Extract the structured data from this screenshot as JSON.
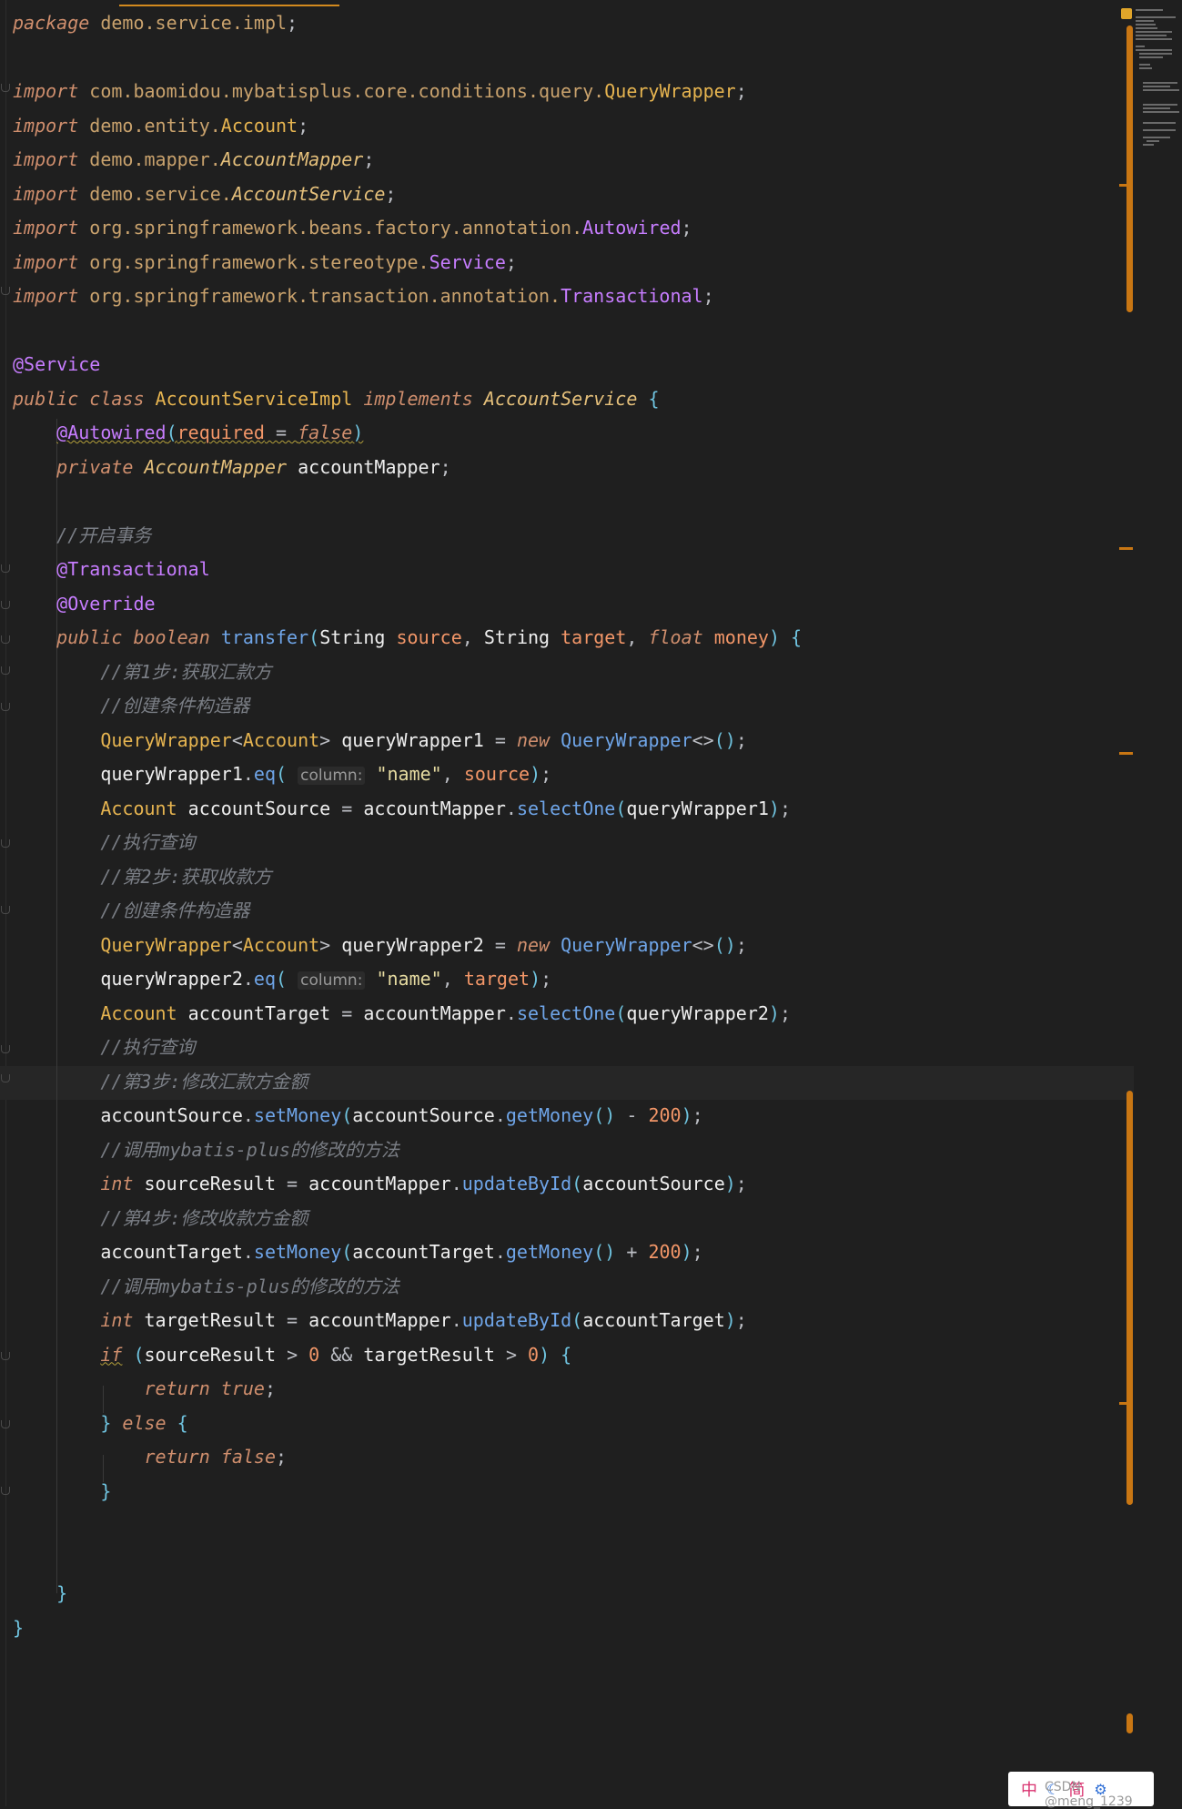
{
  "editor": {
    "language": "Java",
    "lines": [
      {
        "y": 0,
        "html": "<span class='kw'>package</span> <span class='ty'>demo.service.impl</span><span class='punc'>;</span>"
      },
      {
        "y": 2,
        "html": "<span class='kw'>import</span> <span class='ty'>com.baomidou.mybatisplus.core.conditions.query.</span><span class='cls'>QueryWrapper</span><span class='punc'>;</span>"
      },
      {
        "y": 3,
        "html": "<span class='kw'>import</span> <span class='ty'>demo.entity.</span><span class='cls'>Account</span><span class='punc'>;</span>"
      },
      {
        "y": 4,
        "html": "<span class='kw'>import</span> <span class='ty'>demo.mapper.</span><span class='ity'>AccountMapper</span><span class='punc'>;</span>"
      },
      {
        "y": 5,
        "html": "<span class='kw'>import</span> <span class='ty'>demo.service.</span><span class='ity'>AccountService</span><span class='punc'>;</span>"
      },
      {
        "y": 6,
        "html": "<span class='kw'>import</span> <span class='ty'>org.springframework.beans.factory.annotation.</span><span class='ann'>Autowired</span><span class='punc'>;</span>"
      },
      {
        "y": 7,
        "html": "<span class='kw'>import</span> <span class='ty'>org.springframework.stereotype.</span><span class='ann'>Service</span><span class='punc'>;</span>"
      },
      {
        "y": 8,
        "html": "<span class='kw'>import</span> <span class='ty'>org.springframework.transaction.annotation.</span><span class='ann'>Transactional</span><span class='punc'>;</span>"
      },
      {
        "y": 10,
        "html": "<span class='ann'>@Service</span>"
      },
      {
        "y": 11,
        "html": "<span class='kw'>public class</span> <span class='cls'>AccountServiceImpl</span> <span class='kw'>implements</span> <span class='ity'>AccountService</span> <span class='brace'>{</span>"
      },
      {
        "y": 12,
        "html": "    <span class='ann squiggle'>@Autowired</span><span class='brace squiggle'>(</span><span class='var squiggle'>required</span><span class='punc squiggle'> = </span><span class='kw squiggle'>false</span><span class='brace squiggle'>)</span>"
      },
      {
        "y": 13,
        "html": "    <span class='kw'>private</span> <span class='ity'>AccountMapper</span> <span class='plain'>accountMapper</span><span class='punc'>;</span>"
      },
      {
        "y": 15,
        "html": "    <span class='cmt'>//开启事务</span>"
      },
      {
        "y": 16,
        "html": "    <span class='ann'>@Transactional</span>"
      },
      {
        "y": 17,
        "html": "    <span class='ann'>@Override</span>"
      },
      {
        "y": 18,
        "html": "    <span class='kw'>public</span> <span class='kw'>boolean</span> <span class='fn'>transfer</span><span class='brace'>(</span><span class='plain'>String</span> <span class='var'>source</span><span class='punc'>, </span><span class='plain'>String</span> <span class='var'>target</span><span class='punc'>, </span><span class='kw'>float</span> <span class='var'>money</span><span class='brace'>)</span> <span class='brace'>{</span>"
      },
      {
        "y": 19,
        "html": "        <span class='cmt'>//第1步:获取汇款方</span>"
      },
      {
        "y": 20,
        "html": "        <span class='cmt'>//创建条件构造器</span>"
      },
      {
        "y": 21,
        "html": "        <span class='cls'>QueryWrapper</span><span class='punc'>&lt;</span><span class='cls'>Account</span><span class='punc'>&gt;</span> <span class='plain'>queryWrapper1</span> <span class='punc'>=</span> <span class='kw'>new</span> <span class='fn'>QueryWrapper</span><span class='punc'>&lt;&gt;</span><span class='brace'>()</span><span class='punc'>;</span>"
      },
      {
        "y": 22,
        "html": "        <span class='plain'>queryWrapper1</span><span class='punc'>.</span><span class='fn'>eq</span><span class='brace'>(</span> <span class='hint'>column:</span> <span class='str'>\"name\"</span><span class='punc'>, </span><span class='var'>source</span><span class='brace'>)</span><span class='punc'>;</span>"
      },
      {
        "y": 23,
        "html": "        <span class='cls'>Account</span> <span class='plain'>accountSource</span> <span class='punc'>=</span> <span class='plain'>accountMapper</span><span class='punc'>.</span><span class='fn'>selectOne</span><span class='brace'>(</span><span class='plain'>queryWrapper1</span><span class='brace'>)</span><span class='punc'>;</span>"
      },
      {
        "y": 24,
        "html": "        <span class='cmt'>//执行查询</span>"
      },
      {
        "y": 25,
        "html": "        <span class='cmt'>//第2步:获取收款方</span>"
      },
      {
        "y": 26,
        "html": "        <span class='cmt'>//创建条件构造器</span>"
      },
      {
        "y": 27,
        "html": "        <span class='cls'>QueryWrapper</span><span class='punc'>&lt;</span><span class='cls'>Account</span><span class='punc'>&gt;</span> <span class='plain'>queryWrapper2</span> <span class='punc'>=</span> <span class='kw'>new</span> <span class='fn'>QueryWrapper</span><span class='punc'>&lt;&gt;</span><span class='brace'>()</span><span class='punc'>;</span>"
      },
      {
        "y": 28,
        "html": "        <span class='plain'>queryWrapper2</span><span class='punc'>.</span><span class='fn'>eq</span><span class='brace'>(</span> <span class='hint'>column:</span> <span class='str'>\"name\"</span><span class='punc'>, </span><span class='var'>target</span><span class='brace'>)</span><span class='punc'>;</span>"
      },
      {
        "y": 29,
        "html": "        <span class='cls'>Account</span> <span class='plain'>accountTarget</span> <span class='punc'>=</span> <span class='plain'>accountMapper</span><span class='punc'>.</span><span class='fn'>selectOne</span><span class='brace'>(</span><span class='plain'>queryWrapper2</span><span class='brace'>)</span><span class='punc'>;</span>"
      },
      {
        "y": 30,
        "html": "        <span class='cmt'>//执行查询</span>"
      },
      {
        "y": 31,
        "html": "        <span class='cmt'>//第3步:修改汇款方金额</span>"
      },
      {
        "y": 32,
        "html": "        <span class='plain'>accountSource</span><span class='punc'>.</span><span class='fn'>setMoney</span><span class='brace'>(</span><span class='plain'>accountSource</span><span class='punc'>.</span><span class='fn'>getMoney</span><span class='brace'>()</span> <span class='punc'>-</span> <span class='num'>200</span><span class='brace'>)</span><span class='punc'>;</span>"
      },
      {
        "y": 33,
        "html": "        <span class='cmt'>//调用mybatis-plus的修改的方法</span>"
      },
      {
        "y": 34,
        "html": "        <span class='kw'>int</span> <span class='plain'>sourceResult</span> <span class='punc'>=</span> <span class='plain'>accountMapper</span><span class='punc'>.</span><span class='fn'>updateById</span><span class='brace'>(</span><span class='plain'>accountSource</span><span class='brace'>)</span><span class='punc'>;</span>"
      },
      {
        "y": 35,
        "html": "        <span class='cmt'>//第4步:修改收款方金额</span>"
      },
      {
        "y": 36,
        "html": "        <span class='plain'>accountTarget</span><span class='punc'>.</span><span class='fn'>setMoney</span><span class='brace'>(</span><span class='plain'>accountTarget</span><span class='punc'>.</span><span class='fn'>getMoney</span><span class='brace'>()</span> <span class='punc'>+</span> <span class='num'>200</span><span class='brace'>)</span><span class='punc'>;</span>"
      },
      {
        "y": 37,
        "html": "        <span class='cmt'>//调用mybatis-plus的修改的方法</span>"
      },
      {
        "y": 38,
        "html": "        <span class='kw'>int</span> <span class='plain'>targetResult</span> <span class='punc'>=</span> <span class='plain'>accountMapper</span><span class='punc'>.</span><span class='fn'>updateById</span><span class='brace'>(</span><span class='plain'>accountTarget</span><span class='brace'>)</span><span class='punc'>;</span>"
      },
      {
        "y": 39,
        "html": "        <span class='kw squiggle'>if</span> <span class='brace'>(</span><span class='plain'>sourceResult</span> <span class='punc'>&gt;</span> <span class='num'>0</span> <span class='punc'>&amp;&amp;</span> <span class='plain'>targetResult</span> <span class='punc'>&gt;</span> <span class='num'>0</span><span class='brace'>)</span> <span class='brace'>{</span>"
      },
      {
        "y": 40,
        "html": "            <span class='kw'>return true</span><span class='punc'>;</span>"
      },
      {
        "y": 41,
        "html": "        <span class='brace'>}</span> <span class='kw'>else</span> <span class='brace'>{</span>"
      },
      {
        "y": 42,
        "html": "            <span class='kw'>return false</span><span class='punc'>;</span>"
      },
      {
        "y": 43,
        "html": "        <span class='brace'>}</span>"
      },
      {
        "y": 46,
        "html": "    <span class='brace'>}</span>"
      },
      {
        "y": 47,
        "html": "<span class='brace'>}</span>"
      }
    ]
  },
  "ime": {
    "mode_label": "中",
    "simplified_label": "简",
    "watermark": "CSDN @meng_1239"
  },
  "colors": {
    "background": "#1f1f1f",
    "scrollbar": "#c87613",
    "keyword": "#cf8e6d",
    "annotation": "#c77dff",
    "method": "#6fa5e8",
    "comment": "#7a7e85"
  }
}
